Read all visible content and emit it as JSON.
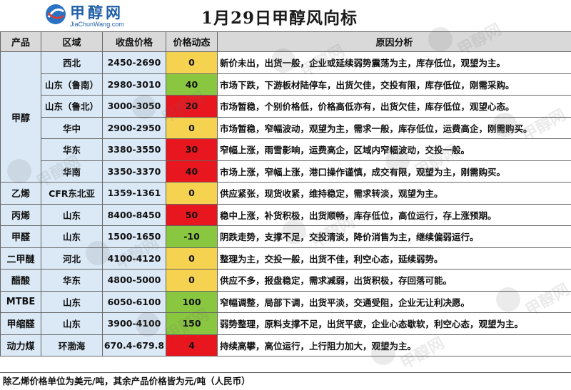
{
  "header": {
    "logo_text": "甲醇网",
    "logo_url_text": "JiaChunWang.com",
    "title": "1月29日甲醇风向标"
  },
  "table": {
    "columns": [
      "产品",
      "区域",
      "收盘价格",
      "价格动态",
      "原因分析"
    ],
    "groups": [
      {
        "product": "甲醇",
        "rows": [
          {
            "region": "西北",
            "price": "2450-2690",
            "change": "0",
            "change_color": "#f5d250",
            "analysis": "新价未出，出货一般，企业或延续弱势震荡为主，库存低位，观望为主。"
          },
          {
            "region": "山东（鲁南）",
            "price": "2980-3010",
            "change": "40",
            "change_color": "#8ac740",
            "analysis": "市场下跌，下游板材陆停车，出货欠佳，交投有限，库存低位，刚需采购。"
          },
          {
            "region": "山东（鲁北）",
            "price": "3000-3050",
            "change": "20",
            "change_color": "#e8161e",
            "analysis": "市场暂稳，个别价格低，价格高低亦有，出货欠佳，库存低位，观望心态。"
          },
          {
            "region": "华中",
            "price": "2900-2950",
            "change": "0",
            "change_color": "#f5d250",
            "analysis": "市场暂稳，窄幅波动，观望为主，需求一般，库存低位，运费高企，刚需购买。"
          },
          {
            "region": "华东",
            "price": "3380-3550",
            "change": "30",
            "change_color": "#e8161e",
            "analysis": "窄幅上涨，雨雪影响，运费高企，区域内窄幅波动，交投一般。"
          },
          {
            "region": "华南",
            "price": "3350-3370",
            "change": "40",
            "change_color": "#e8161e",
            "analysis": "市场上涨，窄幅上涨，港口操作谨慎，成交有限，观望为主，刚需购买。"
          }
        ]
      },
      {
        "product": "乙烯",
        "rows": [
          {
            "region": "CFR东北亚",
            "price": "1359-1361",
            "change": "0",
            "change_color": "#f5d250",
            "analysis": "供应紧张，现货收紧，维持稳定，需求转淡，观望为主。"
          }
        ]
      },
      {
        "product": "丙烯",
        "rows": [
          {
            "region": "山东",
            "price": "8400-8450",
            "change": "50",
            "change_color": "#e8161e",
            "analysis": "稳中上涨，补货积极，出货顺畅，库存低位，高位运行，存上涨预期。"
          }
        ]
      },
      {
        "product": "甲醛",
        "rows": [
          {
            "region": "山东",
            "price": "1500-1650",
            "change": "-10",
            "change_color": "#8ac740",
            "analysis": "阴跌走势，支撑不足，交投清淡，降价消售为主，继续偏弱运行。"
          }
        ]
      },
      {
        "product": "二甲醚",
        "rows": [
          {
            "region": "河北",
            "price": "4100-4120",
            "change": "0",
            "change_color": "#f5d250",
            "analysis": "整理为主，交投一般，出货不佳，利空心态，延续弱势。"
          }
        ]
      },
      {
        "product": "醋酸",
        "rows": [
          {
            "region": "华东",
            "price": "4800-5000",
            "change": "0",
            "change_color": "#f5d250",
            "analysis": "供应不多，报盘稳定，需求减弱，出货积极，存回落可能。"
          }
        ]
      },
      {
        "product": "MTBE",
        "rows": [
          {
            "region": "山东",
            "price": "6050-6100",
            "change": "100",
            "change_color": "#8ac740",
            "analysis": "窄幅调整，局部下调，出货平淡，交通受阻，企业无让利决愿。"
          }
        ]
      },
      {
        "product": "甲缩醛",
        "rows": [
          {
            "region": "山东",
            "price": "3900-4100",
            "change": "150",
            "change_color": "#8ac740",
            "analysis": "弱势整理，原料支撑不足，出货平疲，企业心态歇软，利空心态，观望为主。"
          }
        ]
      },
      {
        "product": "动力煤",
        "rows": [
          {
            "region": "环渤海",
            "price": "670.4-679.8",
            "change": "4",
            "change_color": "#e8161e",
            "analysis": "持续高攀，高位运行，上行阻力加大，观望为主。"
          }
        ]
      }
    ]
  },
  "footer": {
    "note": "除乙烯价格单位为美元/吨，其余产品价格皆为元/吨（人民币）"
  },
  "watermark": {
    "text": "甲醇网"
  }
}
